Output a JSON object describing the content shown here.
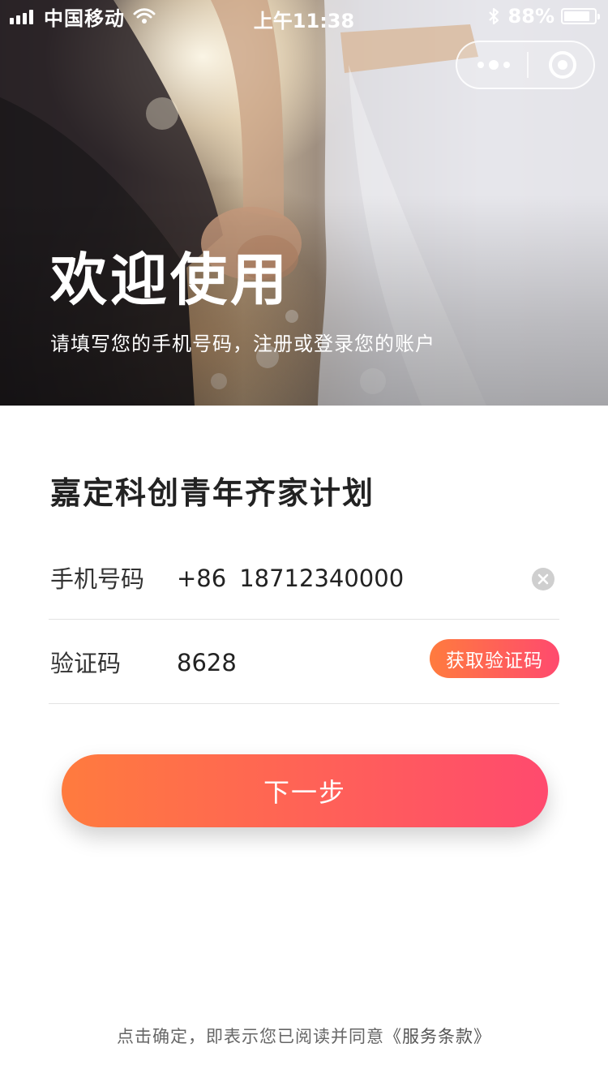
{
  "status_bar": {
    "carrier": "中国移动",
    "time": "上午11:38",
    "battery_text": "88%",
    "battery_level": 0.88,
    "icons": [
      "signal-icon",
      "wifi-icon",
      "bluetooth-icon",
      "battery-icon"
    ]
  },
  "capsule": {
    "icons": [
      "more-icon",
      "close-mini-program-icon"
    ]
  },
  "hero": {
    "title": "欢迎使用",
    "subtitle": "请填写您的手机号码，注册或登录您的账户"
  },
  "form": {
    "title": "嘉定科创青年齐家计划",
    "phone": {
      "label": "手机号码",
      "country_code": "+86",
      "value": "18712340000",
      "clear_icon": "clear-icon"
    },
    "code": {
      "label": "验证码",
      "value": "8628",
      "button_label": "获取验证码"
    }
  },
  "next_button": {
    "label": "下一步"
  },
  "footer": {
    "text": "点击确定，即表示您已阅读并同意",
    "terms_link": "《服务条款》"
  },
  "colors": {
    "accent_start": "#ff7b3e",
    "accent_end": "#ff4a6e",
    "text_primary": "#222222",
    "divider": "#e3e3e3"
  }
}
